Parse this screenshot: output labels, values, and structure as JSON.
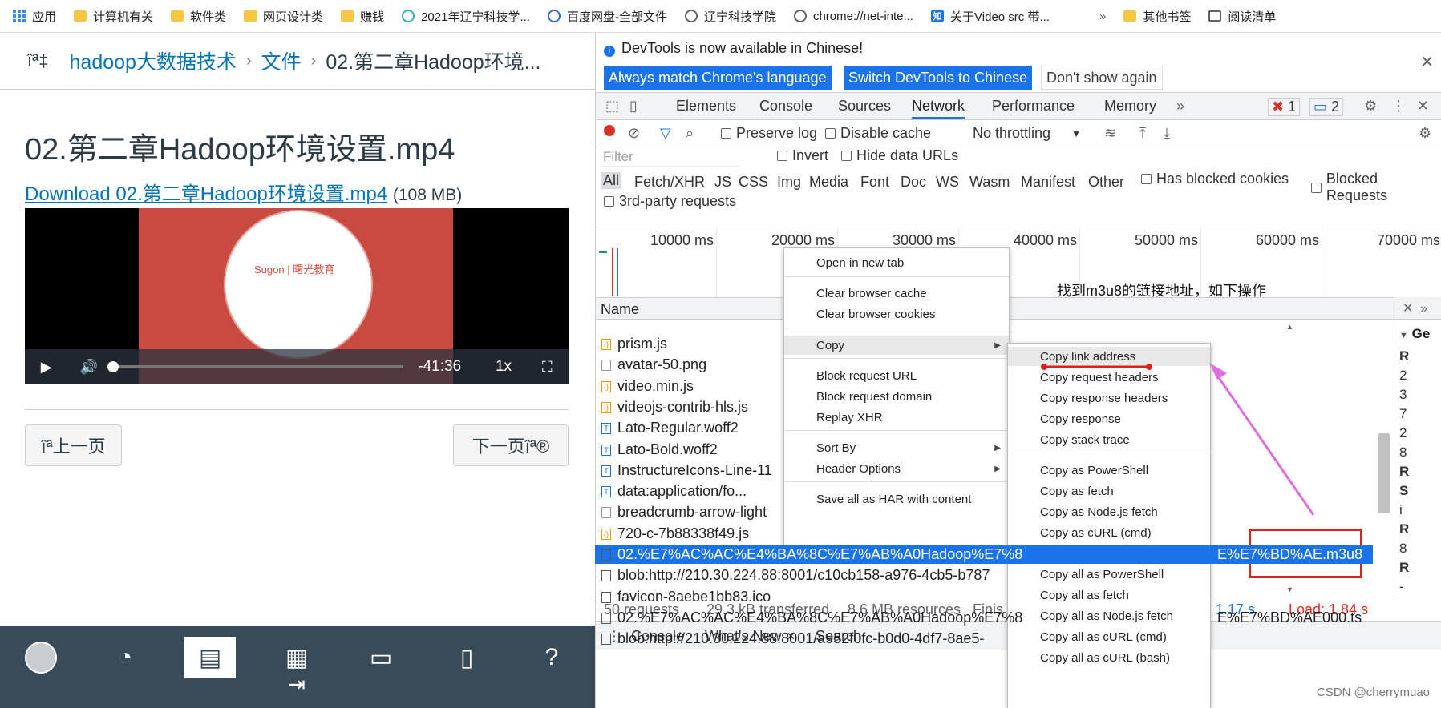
{
  "bookmarks": [
    {
      "label": "应用",
      "icon": "apps-grid-icon"
    },
    {
      "label": "计算机有关",
      "icon": "folder-icon"
    },
    {
      "label": "软件类",
      "icon": "folder-icon"
    },
    {
      "label": "网页设计类",
      "icon": "folder-icon"
    },
    {
      "label": "赚钱",
      "icon": "folder-icon"
    },
    {
      "label": "2021年辽宁科技学...",
      "icon": "site-icon"
    },
    {
      "label": "百度网盘-全部文件",
      "icon": "baidu-icon"
    },
    {
      "label": "辽宁科技学院",
      "icon": "site-icon"
    },
    {
      "label": "chrome://net-inte...",
      "icon": "globe-icon"
    },
    {
      "label": "关于Video src 带...",
      "icon": "zhihu-icon"
    }
  ],
  "bookmarks_right": {
    "more": "»",
    "other": "其他书签",
    "reading": "阅读清单"
  },
  "page": {
    "logo_glyph": "î",
    "logo_text": "ª‡",
    "breadcrumb": [
      "hadoop大数据技术",
      "文件",
      "02.第二章Hadoop环境..."
    ],
    "title": "02.第二章Hadoop环境设置.mp4",
    "download_link": "Download 02.第二章Hadoop环境设置.mp4",
    "download_size": "(108 MB)",
    "video": {
      "brand": "Sugon | 曙光教育",
      "time": "-41:36",
      "rate": "1x",
      "progress": 0.0
    },
    "prev_button": "îª上一页",
    "next_button": "下一页îª®"
  },
  "devtools": {
    "info_message": "DevTools is now available in Chinese!",
    "info_buttons": [
      "Always match Chrome's language",
      "Switch DevTools to Chinese",
      "Don't show again"
    ],
    "tabs": [
      "Elements",
      "Console",
      "Sources",
      "Network",
      "Performance",
      "Memory"
    ],
    "active_tab": "Network",
    "tabs_more": "»",
    "error_count": "1",
    "message_count": "2",
    "toolbar": {
      "preserve_log": "Preserve log",
      "disable_cache": "Disable cache",
      "throttling": "No throttling"
    },
    "filter_placeholder": "Filter",
    "invert": "Invert",
    "hide_data_urls": "Hide data URLs",
    "type_filters": [
      "All",
      "Fetch/XHR",
      "JS",
      "CSS",
      "Img",
      "Media",
      "Font",
      "Doc",
      "WS",
      "Wasm",
      "Manifest",
      "Other"
    ],
    "has_blocked_cookies": "Has blocked cookies",
    "blocked_requests": "Blocked Requests",
    "third_party": "3rd-party requests",
    "timeline_ticks": [
      "10000 ms",
      "20000 ms",
      "30000 ms",
      "40000 ms",
      "50000 ms",
      "60000 ms",
      "70000 ms"
    ],
    "annotation": "找到m3u8的链接地址，如下操作",
    "name_header": "Name",
    "requests": [
      {
        "name": "prism.js",
        "type": "js"
      },
      {
        "name": "avatar-50.png",
        "type": "img"
      },
      {
        "name": "video.min.js",
        "type": "js"
      },
      {
        "name": "videojs-contrib-hls.js",
        "type": "js"
      },
      {
        "name": "Lato-Regular.woff2",
        "type": "font"
      },
      {
        "name": "Lato-Bold.woff2",
        "type": "font"
      },
      {
        "name": "InstructureIcons-Line-11",
        "type": "font"
      },
      {
        "name": "data:application/fo...",
        "type": "font"
      },
      {
        "name": "breadcrumb-arrow-light",
        "type": "img"
      },
      {
        "name": "720-c-7b88338f49.js",
        "type": "js"
      },
      {
        "name": "02.%E7%AC%AC%E4%BA%8C%E7%AB%A0Hadoop%E7%8",
        "type": "doc",
        "selected": true,
        "tail": "E%E7%BD%AE.m3u8"
      },
      {
        "name": "blob:http://210.30.224.88:8001/c10cb158-a976-4cb5-b787",
        "type": "doc"
      },
      {
        "name": "favicon-8aebe1bb83.ico",
        "type": "doc"
      },
      {
        "name": "02.%E7%AC%AC%E4%BA%8C%E7%AB%A0Hadoop%E7%8",
        "type": "doc",
        "tail": "E%E7%BD%AE000.ts"
      },
      {
        "name": "blob:http://210.30.224.88:8001/a952f0fc-b0d0-4df7-8ae5-",
        "type": "doc"
      }
    ],
    "status": {
      "requests": "50 requests",
      "transferred": "29.3 kB transferred",
      "resources": "8.6 MB resources",
      "finish": "Finis",
      "dcl": "ed: 1.17 s",
      "load": "Load: 1.84 s"
    },
    "drawer_tabs": [
      "Console",
      "What's New",
      "Search"
    ],
    "side_header": "Ge",
    "side_letters": [
      "R",
      "2",
      "3",
      "7",
      "2",
      "8",
      "R",
      "S",
      "i",
      "R",
      "8",
      "R",
      "-"
    ]
  },
  "context_menu": {
    "items": [
      {
        "label": "Open in new tab"
      },
      {
        "label": "Clear browser cache"
      },
      {
        "label": "Clear browser cookies"
      },
      {
        "label": "Copy",
        "submenu": true
      },
      {
        "label": "Block request URL"
      },
      {
        "label": "Block request domain"
      },
      {
        "label": "Replay XHR"
      },
      {
        "label": "Sort By",
        "submenu": true
      },
      {
        "label": "Header Options",
        "submenu": true
      },
      {
        "label": "Save all as HAR with content"
      }
    ]
  },
  "copy_submenu": {
    "items": [
      "Copy link address",
      "Copy request headers",
      "Copy response headers",
      "Copy response",
      "Copy stack trace",
      "Copy as PowerShell",
      "Copy as fetch",
      "Copy as Node.js fetch",
      "Copy as cURL (cmd)",
      "Copy as cURL (bash)",
      "Copy all as PowerShell",
      "Copy all as fetch",
      "Copy all as Node.js fetch",
      "Copy all as cURL (cmd)",
      "Copy all as cURL (bash)"
    ]
  },
  "watermark": "CSDN @cherrymuao",
  "colors": {
    "accent": "#1a73e8",
    "canvas_link": "#0374b5",
    "annotation_red": "#e0201b",
    "annotation_pink": "#e06ee0",
    "nav_bg": "#394b58"
  }
}
